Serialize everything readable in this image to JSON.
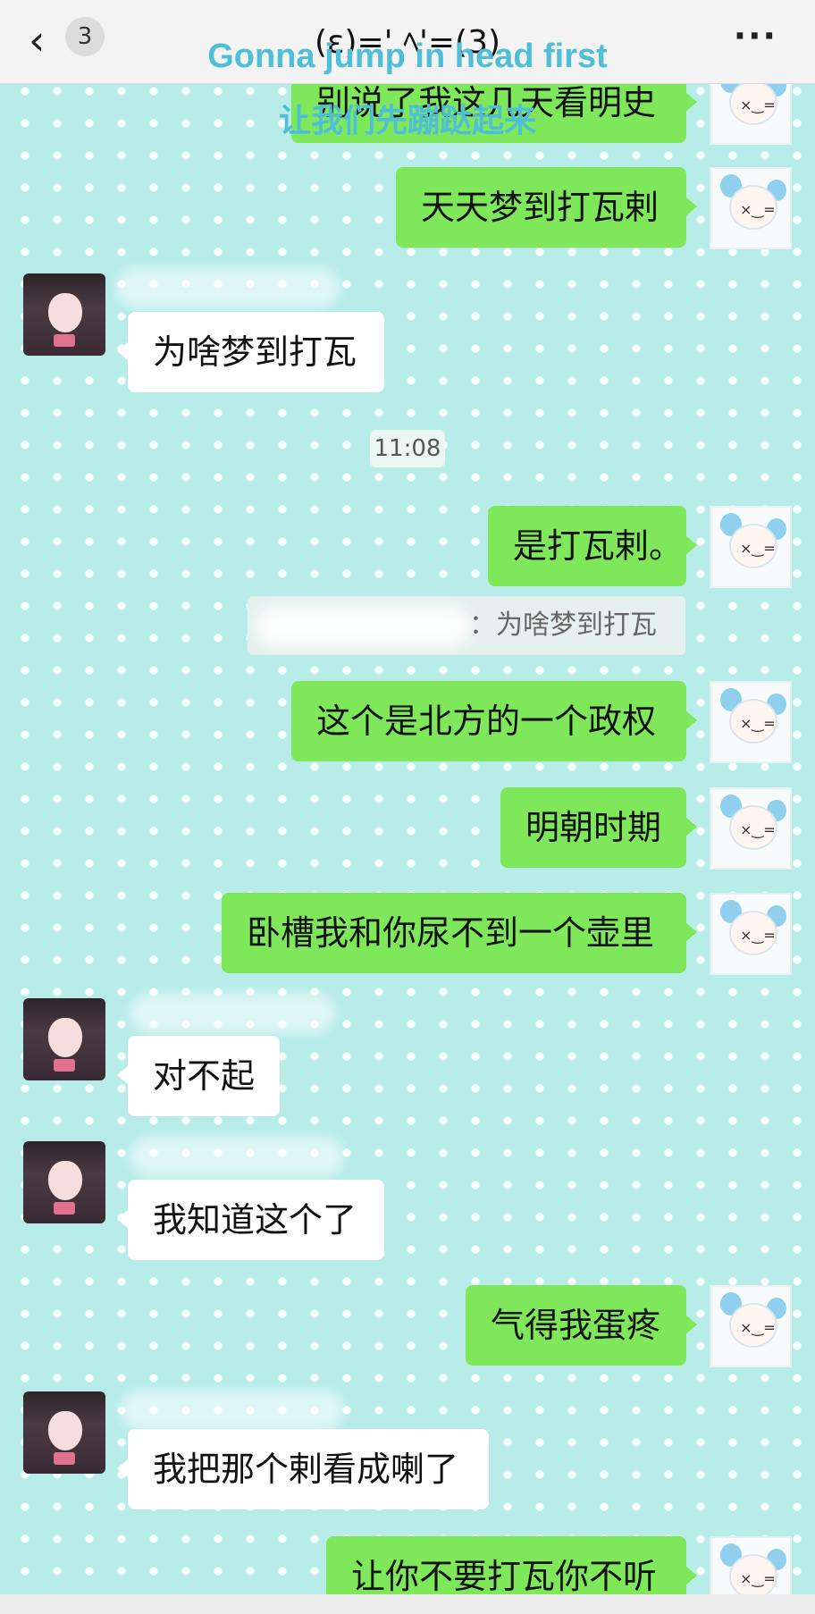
{
  "header": {
    "back_icon": "chevron-left-icon",
    "unread_count": "3",
    "title": "(ε)=' ﾍ'=(3)",
    "more_icon": "more-dots-icon"
  },
  "overlay": {
    "english": "Gonna jump in head first",
    "chinese": "让我们先蹦跶起来"
  },
  "messages": [
    {
      "side": "out",
      "text": "别说了我这几天看明史"
    },
    {
      "side": "out",
      "text": "天天梦到打瓦剌"
    },
    {
      "side": "in",
      "text": "为啥梦到打瓦"
    },
    {
      "side": "out",
      "text": "是打瓦剌。"
    },
    {
      "side": "out",
      "text": "这个是北方的一个政权"
    },
    {
      "side": "out",
      "text": "明朝时期"
    },
    {
      "side": "out",
      "text": "卧槽我和你尿不到一个壶里"
    },
    {
      "side": "in",
      "text": "对不起"
    },
    {
      "side": "in",
      "text": "我知道这个了"
    },
    {
      "side": "out",
      "text": "气得我蛋疼"
    },
    {
      "side": "in",
      "text": "我把那个剌看成喇了"
    },
    {
      "side": "out",
      "text": "让你不要打瓦你不听"
    }
  ],
  "timestamp": "11:08",
  "quote": {
    "text": "：为啥梦到打瓦"
  },
  "colors": {
    "background": "#b7ece9",
    "outgoing_bubble": "#7ee85a",
    "incoming_bubble": "#ffffff",
    "overlay_text": "#4fbfd8"
  }
}
